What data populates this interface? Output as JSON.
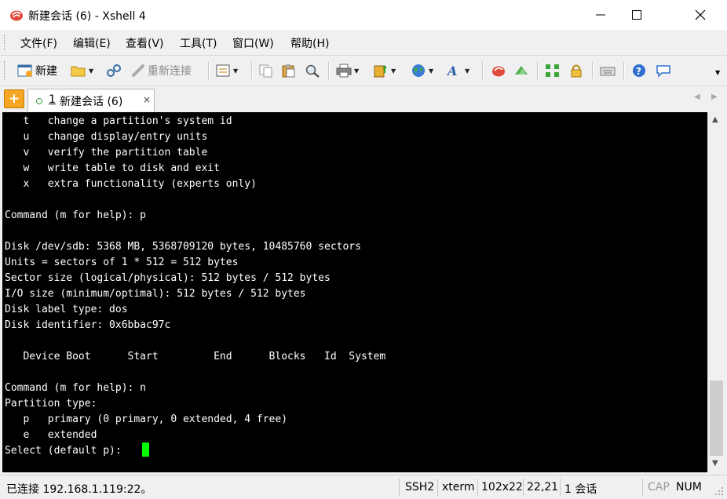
{
  "window": {
    "title": "新建会话 (6) - Xshell 4",
    "colors": {
      "terminal_bg": "#000000",
      "terminal_fg": "#ffffff",
      "cursor": "#00ff00",
      "tab_active_dot": "#3aa63a"
    }
  },
  "menu": {
    "items": [
      {
        "label": "文件(F)"
      },
      {
        "label": "编辑(E)"
      },
      {
        "label": "查看(V)"
      },
      {
        "label": "工具(T)"
      },
      {
        "label": "窗口(W)"
      },
      {
        "label": "帮助(H)"
      }
    ]
  },
  "toolbar": {
    "new_label": "新建",
    "reconnect_label": "重新连接"
  },
  "tabs": [
    {
      "number": "1",
      "label": "新建会话 (6)",
      "close": "×"
    }
  ],
  "terminal": {
    "lines": [
      "   t   change a partition's system id",
      "   u   change display/entry units",
      "   v   verify the partition table",
      "   w   write table to disk and exit",
      "   x   extra functionality (experts only)",
      "",
      "Command (m for help): p",
      "",
      "Disk /dev/sdb: 5368 MB, 5368709120 bytes, 10485760 sectors",
      "Units = sectors of 1 * 512 = 512 bytes",
      "Sector size (logical/physical): 512 bytes / 512 bytes",
      "I/O size (minimum/optimal): 512 bytes / 512 bytes",
      "Disk label type: dos",
      "Disk identifier: 0x6bbac97c",
      "",
      "   Device Boot      Start         End      Blocks   Id  System",
      "",
      "Command (m for help): n",
      "Partition type:",
      "   p   primary (0 primary, 0 extended, 4 free)",
      "   e   extended",
      "Select (default p): "
    ]
  },
  "status": {
    "connection": "已连接 192.168.1.119:22。",
    "protocol": "SSH2",
    "term_type": "xterm",
    "size": "102x22",
    "cursor_pos": "22,21",
    "sessions": "1 会话",
    "caps": "CAP",
    "num": "NUM"
  }
}
